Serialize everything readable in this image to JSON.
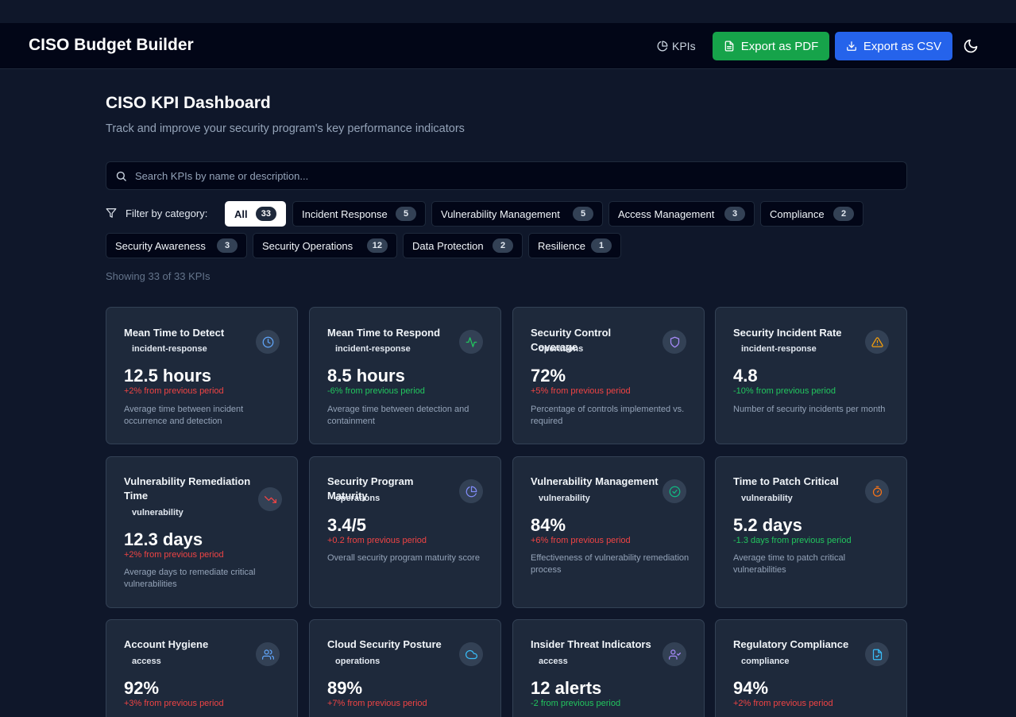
{
  "header": {
    "brand": "CISO Budget Builder",
    "kpis_link": "KPIs",
    "export_pdf": "Export as PDF",
    "export_csv": "Export as CSV"
  },
  "page": {
    "title": "CISO KPI Dashboard",
    "subtitle": "Track and improve your security program's key performance indicators"
  },
  "search": {
    "placeholder": "Search KPIs by name or description..."
  },
  "filter": {
    "label": "Filter by category:",
    "chips": [
      {
        "label": "All",
        "count": "33"
      },
      {
        "label": "Incident Response",
        "count": "5"
      },
      {
        "label": "Vulnerability Management",
        "count": "5"
      },
      {
        "label": "Access Management",
        "count": "3"
      },
      {
        "label": "Compliance",
        "count": "2"
      },
      {
        "label": "Security Awareness",
        "count": "3"
      },
      {
        "label": "Security Operations",
        "count": "12"
      },
      {
        "label": "Data Protection",
        "count": "2"
      },
      {
        "label": "Resilience",
        "count": "1"
      }
    ]
  },
  "showing": "Showing 33 of 33 KPIs",
  "colors": {
    "pdf_button": "#16a34a",
    "csv_button": "#2563eb",
    "positive_change": "#22c55e",
    "negative_change": "#ef4444"
  },
  "cards": [
    {
      "title": "Mean Time to Detect",
      "tag": "incident-response",
      "value": "12.5 hours",
      "change": "+2% from previous period",
      "trend": "up",
      "desc": "Average time between incident occurrence and detection",
      "icon": "clock-icon"
    },
    {
      "title": "Mean Time to Respond",
      "tag": "incident-response",
      "value": "8.5 hours",
      "change": "-6% from previous period",
      "trend": "down",
      "desc": "Average time between detection and containment",
      "icon": "activity-icon"
    },
    {
      "title": "Security Control Coverage",
      "tag": "operations",
      "value": "72%",
      "change": "+5% from previous period",
      "trend": "up",
      "desc": "Percentage of controls implemented vs. required",
      "icon": "shield-icon"
    },
    {
      "title": "Security Incident Rate",
      "tag": "incident-response",
      "value": "4.8",
      "change": "-10% from previous period",
      "trend": "down",
      "desc": "Number of security incidents per month",
      "icon": "warning-icon"
    },
    {
      "title": "Vulnerability Remediation Time",
      "tag": "vulnerability",
      "value": "12.3 days",
      "change": "+2% from previous period",
      "trend": "up",
      "desc": "Average days to remediate critical vulnerabilities",
      "icon": "trending-down-icon"
    },
    {
      "title": "Security Program Maturity",
      "tag": "operations",
      "value": "3.4/5",
      "change": "+0.2 from previous period",
      "trend": "up",
      "desc": "Overall security program maturity score",
      "icon": "pie-chart-icon"
    },
    {
      "title": "Vulnerability Management",
      "tag": "vulnerability",
      "value": "84%",
      "change": "+6% from previous period",
      "trend": "up",
      "desc": "Effectiveness of vulnerability remediation process",
      "icon": "check-circle-icon"
    },
    {
      "title": "Time to Patch Critical",
      "tag": "vulnerability",
      "value": "5.2 days",
      "change": "-1.3 days from previous period",
      "trend": "down",
      "desc": "Average time to patch critical vulnerabilities",
      "icon": "timer-icon"
    },
    {
      "title": "Account Hygiene",
      "tag": "access",
      "value": "92%",
      "change": "+3% from previous period",
      "trend": "up",
      "desc": "",
      "icon": "users-icon"
    },
    {
      "title": "Cloud Security Posture",
      "tag": "operations",
      "value": "89%",
      "change": "+7% from previous period",
      "trend": "up",
      "desc": "",
      "icon": "cloud-icon"
    },
    {
      "title": "Insider Threat Indicators",
      "tag": "access",
      "value": "12 alerts",
      "change": "-2 from previous period",
      "trend": "down",
      "desc": "",
      "icon": "user-check-icon"
    },
    {
      "title": "Regulatory Compliance",
      "tag": "compliance",
      "value": "94%",
      "change": "+2% from previous period",
      "trend": "up",
      "desc": "",
      "icon": "file-check-icon"
    }
  ]
}
